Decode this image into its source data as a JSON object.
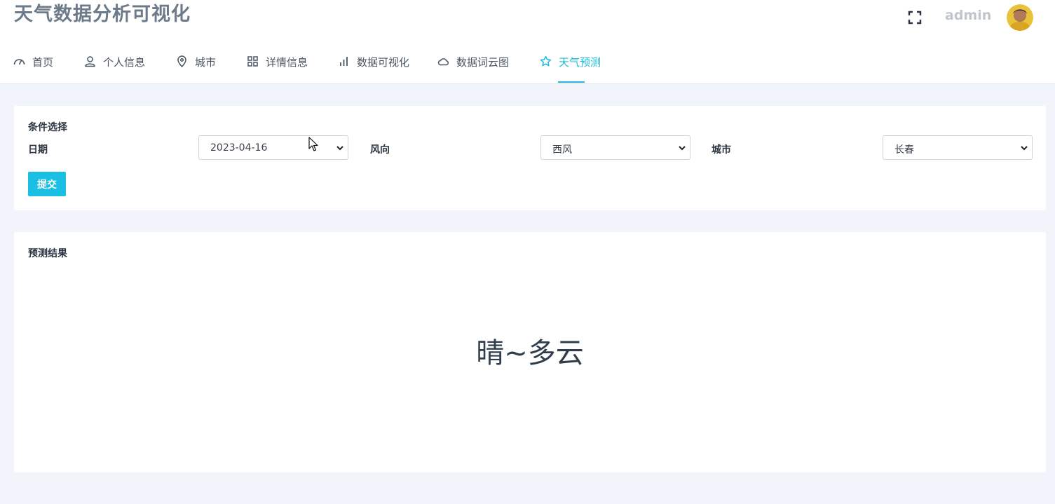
{
  "app": {
    "title": "天气数据分析可视化",
    "username": "admin"
  },
  "header": {
    "fullscreen_icon": "fullscreen-icon",
    "avatar_icon": "user-avatar"
  },
  "nav": {
    "items": [
      {
        "label": "首页",
        "icon": "speedometer-icon"
      },
      {
        "label": "个人信息",
        "icon": "user-icon"
      },
      {
        "label": "城市",
        "icon": "map-pin-icon"
      },
      {
        "label": "详情信息",
        "icon": "grid-icon"
      },
      {
        "label": "数据可视化",
        "icon": "bar-chart-icon"
      },
      {
        "label": "数据词云图",
        "icon": "cloud-icon"
      },
      {
        "label": "天气预测",
        "icon": "star-icon",
        "active": true
      }
    ],
    "active_color": "#1fbadc"
  },
  "filters": {
    "title": "条件选择",
    "date_label": "日期",
    "date_value": "2023-04-16",
    "wind_label": "风向",
    "wind_value": "西风",
    "city_label": "城市",
    "city_value": "长春",
    "submit_label": "提交",
    "submit_color": "#1cbfe4"
  },
  "result": {
    "title": "预测结果",
    "value": "晴~多云"
  }
}
